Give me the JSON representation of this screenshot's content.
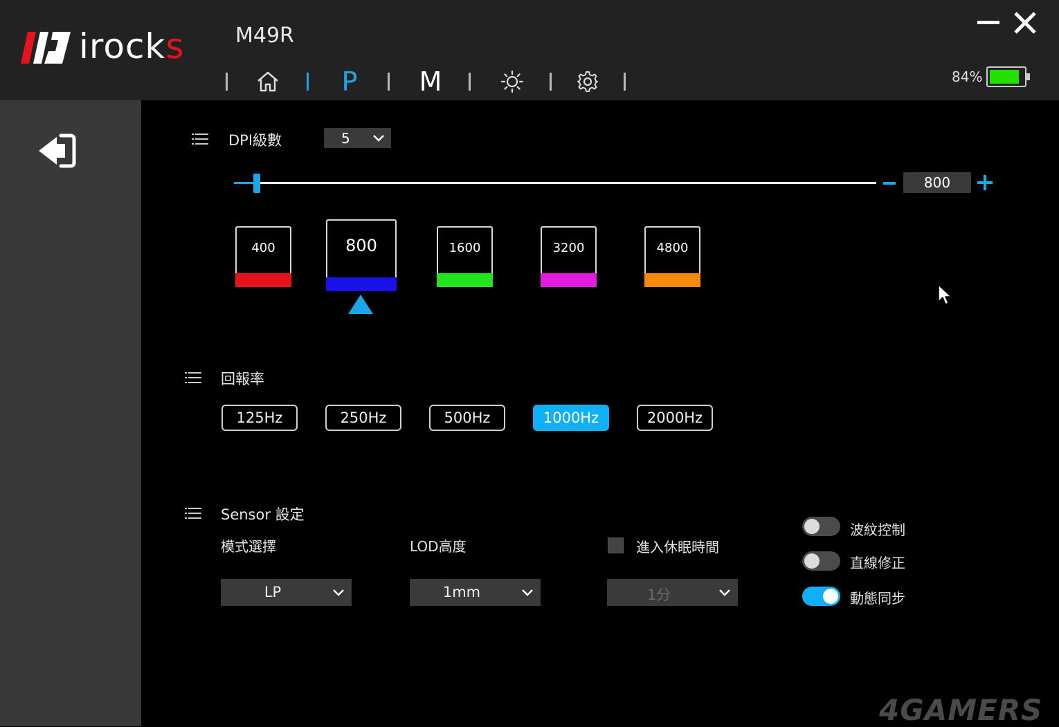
{
  "header": {
    "brand": {
      "name_main": "irock",
      "name_tail": "s"
    },
    "model": "M49R",
    "nav": [
      {
        "id": "home",
        "icon": "home-icon"
      },
      {
        "id": "performance",
        "label": "P",
        "active": true
      },
      {
        "id": "macro",
        "label": "M"
      },
      {
        "id": "lighting",
        "icon": "sun-icon"
      },
      {
        "id": "settings",
        "icon": "gear-icon"
      }
    ],
    "battery": {
      "percent_label": "84%",
      "level": 0.84,
      "color": "#22e000"
    }
  },
  "dpi": {
    "title": "DPI級數",
    "levels_selected": "5",
    "current_value": "800",
    "slider_min": 100,
    "slider_max": 26000,
    "slider_value": 800,
    "selected_index": 1,
    "stages": [
      {
        "value": "400",
        "color": "#e8131a"
      },
      {
        "value": "800",
        "color": "#1a10e8"
      },
      {
        "value": "1600",
        "color": "#22e61c"
      },
      {
        "value": "3200",
        "color": "#e21be0"
      },
      {
        "value": "4800",
        "color": "#f68a0c"
      }
    ]
  },
  "polling": {
    "title": "回報率",
    "rates": [
      {
        "label": "125Hz"
      },
      {
        "label": "250Hz"
      },
      {
        "label": "500Hz"
      },
      {
        "label": "1000Hz",
        "active": true
      },
      {
        "label": "2000Hz"
      }
    ]
  },
  "sensor": {
    "title": "Sensor 設定",
    "mode": {
      "label": "模式選擇",
      "value": "LP"
    },
    "lod": {
      "label": "LOD高度",
      "value": "1mm"
    },
    "sleep": {
      "label": "進入休眠時間",
      "checked": false,
      "value": "1分"
    },
    "toggles": [
      {
        "label": "波紋控制",
        "on": false
      },
      {
        "label": "直線修正",
        "on": false
      },
      {
        "label": "動態同步",
        "on": true
      }
    ]
  },
  "watermark": "4GAMERS",
  "accent_color": "#0fb0f5"
}
